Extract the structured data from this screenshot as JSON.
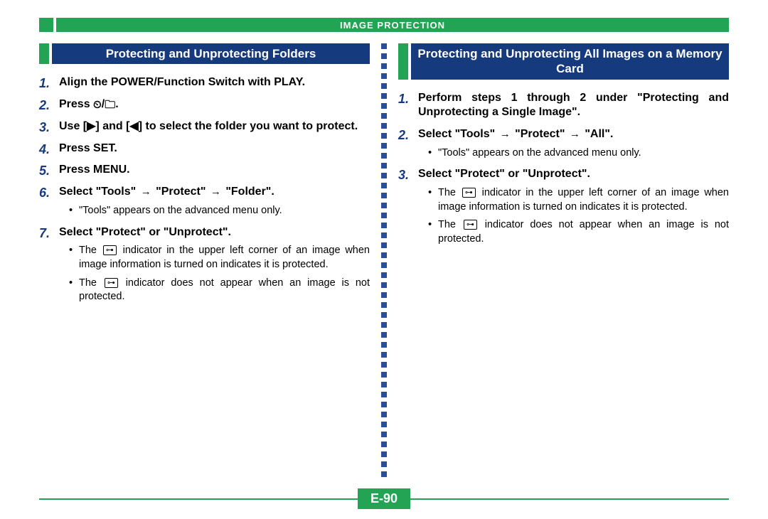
{
  "header": {
    "title": "IMAGE PROTECTION"
  },
  "left": {
    "title": "Protecting and Unprotecting Folders",
    "steps": {
      "s1": "Align the POWER/Function Switch with PLAY.",
      "s2a": "Press ",
      "s2b": ".",
      "s3": "Use [▶] and [◀] to select the folder you want to protect.",
      "s4": "Press SET.",
      "s5": "Press MENU.",
      "s6a": "Select \"Tools\" ",
      "s6b": " \"Protect\" ",
      "s6c": " \"Folder\".",
      "s7": "Select \"Protect\" or \"Unprotect\"."
    },
    "sub6": {
      "a": "\"Tools\" appears on the advanced menu only."
    },
    "sub7": {
      "a1": "The ",
      "a2": " indicator in the upper left corner of an image when image information is turned on indicates it is protected.",
      "b1": "The ",
      "b2": " indicator does not appear when an image is not protected."
    }
  },
  "right": {
    "title": "Protecting and Unprotecting All Images on a Memory Card",
    "steps": {
      "s1": "Perform steps 1 through 2 under \"Protecting and Unprotecting a Single Image\".",
      "s2a": "Select \"Tools\" ",
      "s2b": " \"Protect\" ",
      "s2c": " \"All\".",
      "s3": "Select \"Protect\" or \"Unprotect\"."
    },
    "sub2": {
      "a": "\"Tools\" appears on the advanced menu only."
    },
    "sub3": {
      "a1": "The ",
      "a2": " indicator in the upper left corner of an image when image information is turned on indicates it is protected.",
      "b1": "The ",
      "b2": " indicator does not appear when an image is not protected."
    }
  },
  "icons": {
    "timer": "⏲",
    "folder": "🗀",
    "key": "⊶",
    "arrow": "→"
  },
  "footer": {
    "page": "E-90"
  }
}
